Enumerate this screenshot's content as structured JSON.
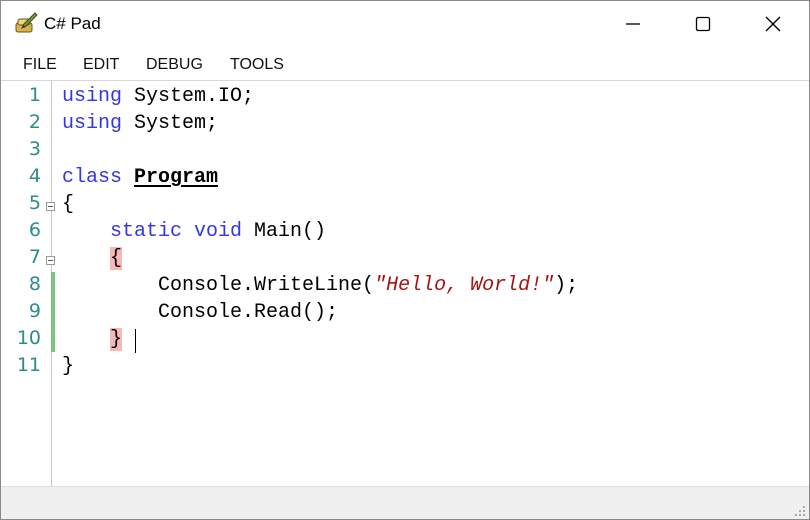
{
  "window": {
    "title": "C# Pad"
  },
  "menu": [
    "FILE",
    "EDIT",
    "DEBUG",
    "TOOLS"
  ],
  "line_numbers": [
    "1",
    "2",
    "3",
    "4",
    "5",
    "6",
    "7",
    "8",
    "9",
    "10",
    "11"
  ],
  "code": {
    "l1": {
      "kw": "using",
      "rest": " System.IO;"
    },
    "l2": {
      "kw": "using",
      "rest": " System;"
    },
    "l4": {
      "kw": "class",
      "sp": " ",
      "name": "Program"
    },
    "l5": "{",
    "l6": {
      "indent": "    ",
      "kw": "static void",
      "rest": " Main()"
    },
    "l7": {
      "indent": "    ",
      "brace": "{"
    },
    "l8": {
      "indent": "        ",
      "pre": "Console.WriteLine(",
      "str": "\"Hello, World!\"",
      "post": ");"
    },
    "l9": {
      "indent": "        ",
      "text": "Console.Read();"
    },
    "l10": {
      "indent": "    ",
      "brace": "}"
    },
    "l11": "}"
  },
  "colors": {
    "keyword": "#3636e0",
    "string": "#a31515",
    "line_number": "#2b8c8c",
    "brace_highlight": "#f7b7b7",
    "modified_bar": "#7ec47e"
  }
}
